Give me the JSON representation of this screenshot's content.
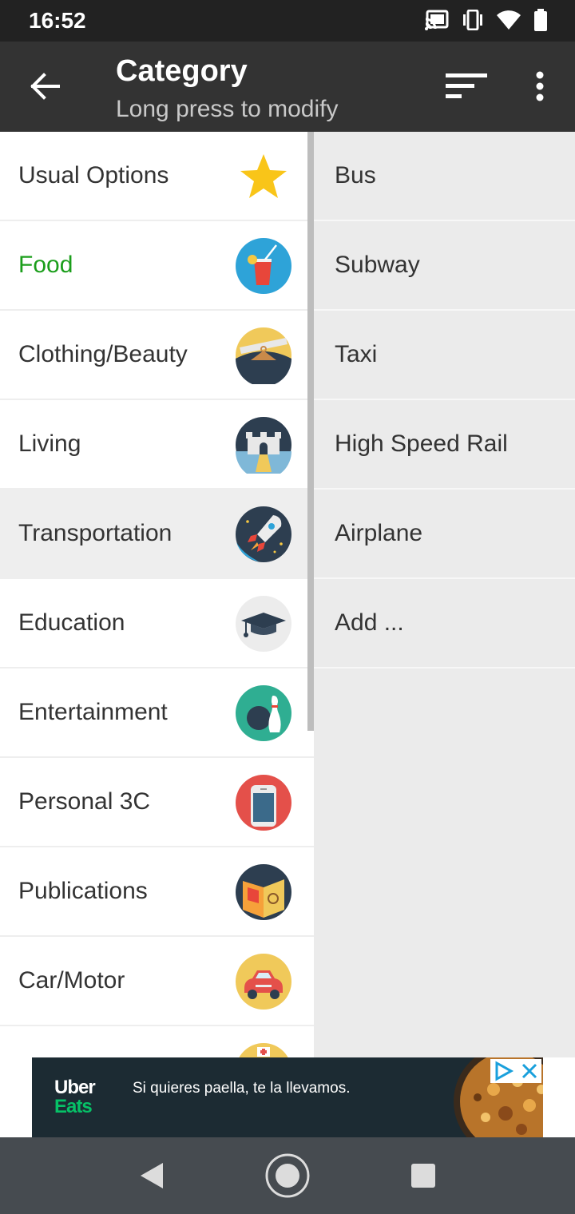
{
  "status_bar": {
    "time": "16:52",
    "icons": [
      "cast-icon",
      "vibrate-icon",
      "wifi-icon",
      "battery-icon"
    ]
  },
  "app_bar": {
    "title": "Category",
    "subtitle": "Long press to modify",
    "back_icon": "arrow-left-icon",
    "sort_icon": "sort-icon",
    "more_icon": "more-vert-icon"
  },
  "categories": [
    {
      "label": "Usual Options",
      "icon": "star-icon"
    },
    {
      "label": "Food",
      "icon": "drink-icon",
      "active": true
    },
    {
      "label": "Clothing/Beauty",
      "icon": "hanger-icon"
    },
    {
      "label": "Living",
      "icon": "castle-icon"
    },
    {
      "label": "Transportation",
      "icon": "rocket-icon",
      "selected": true
    },
    {
      "label": "Education",
      "icon": "graduation-cap-icon"
    },
    {
      "label": "Entertainment",
      "icon": "bowling-icon"
    },
    {
      "label": "Personal 3C",
      "icon": "phone-icon"
    },
    {
      "label": "Publications",
      "icon": "book-icon"
    },
    {
      "label": "Car/Motor",
      "icon": "car-icon"
    }
  ],
  "subcategories": [
    {
      "label": "Bus"
    },
    {
      "label": "Subway"
    },
    {
      "label": "Taxi"
    },
    {
      "label": "High Speed Rail"
    },
    {
      "label": "Airplane"
    },
    {
      "label": "Add ..."
    }
  ],
  "ad": {
    "brand_line1": "Uber",
    "brand_line2": "Eats",
    "text": "Si quieres paella, te la llevamos.",
    "colors": {
      "background": "#1c2b33",
      "eats_green": "#06c167"
    }
  },
  "colors": {
    "app_bar": "#333333",
    "status_bar": "#222222",
    "active_category": "#1b9e1b",
    "right_panel": "#ebebeb",
    "nav_bar": "#464b50"
  }
}
